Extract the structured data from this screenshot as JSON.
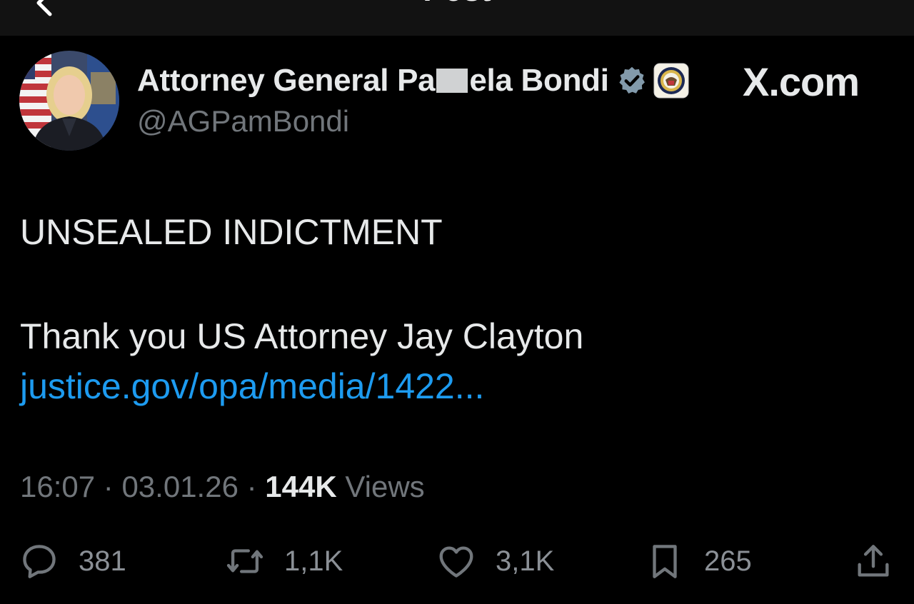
{
  "header": {
    "title": "Post"
  },
  "author": {
    "display_name_start": "Attorney General Pa",
    "display_name_end": "ela Bondi",
    "handle": "@AGPamBondi",
    "verified_badge_color": "#829aab"
  },
  "watermark": {
    "text": "X.com"
  },
  "tweet": {
    "line1": "UNSEALED INDICTMENT",
    "line2": "Thank you US Attorney Jay Clayton",
    "link": "justice.gov/opa/media/1422..."
  },
  "meta": {
    "time": "16:07",
    "separator": "·",
    "date": "03.01.26",
    "views_count": "144K",
    "views_label": "Views"
  },
  "actions": {
    "replies": "381",
    "reposts": "1,1K",
    "likes": "3,1K",
    "bookmarks": "265"
  },
  "icons": {
    "back": "back-arrow-icon",
    "verified": "verified-badge-icon",
    "affiliate": "doj-seal-icon",
    "reply": "reply-icon",
    "repost": "repost-icon",
    "like": "heart-icon",
    "bookmark": "bookmark-icon",
    "share": "share-icon"
  },
  "colors": {
    "background": "#000000",
    "text": "#e7e9ea",
    "secondary_text": "#71767b",
    "link": "#1d9bf0"
  }
}
